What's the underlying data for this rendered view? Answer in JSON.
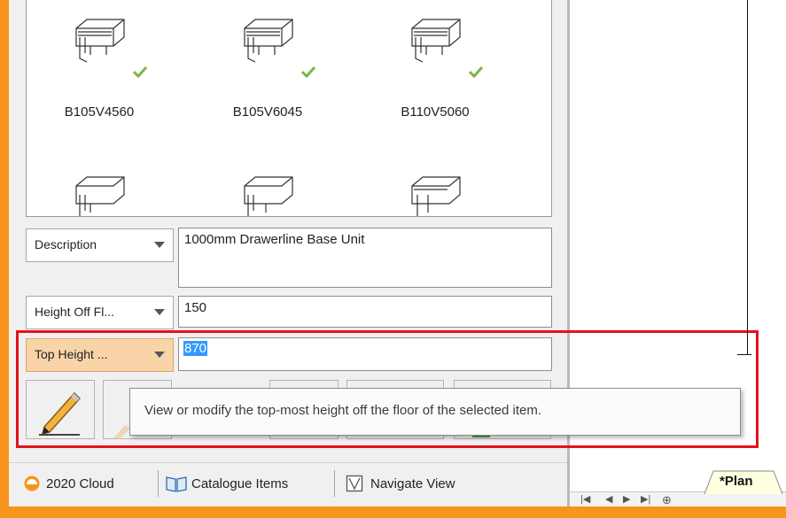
{
  "catalogue": {
    "items": [
      {
        "label": "B105V4560",
        "selected": true
      },
      {
        "label": "B105V6045",
        "selected": true
      },
      {
        "label": "B110V5060",
        "selected": true
      },
      {
        "label": "",
        "selected": false
      },
      {
        "label": "",
        "selected": false
      },
      {
        "label": "",
        "selected": false
      }
    ],
    "scroll_icon": "chevron-down-icon"
  },
  "properties": {
    "description": {
      "dropdown": "Description",
      "value": "1000mm Drawerline Base Unit"
    },
    "height_off_floor": {
      "dropdown": "Height Off Fl...",
      "value": "150"
    },
    "top_height": {
      "dropdown": "Top Height ...",
      "value": "870"
    }
  },
  "tooltip": "View or modify the top-most height off the floor of the selected item.",
  "tabs": [
    {
      "label": "2020 Cloud",
      "icon": "cloud-icon"
    },
    {
      "label": "Catalogue Items",
      "icon": "book-icon"
    },
    {
      "label": "Navigate View",
      "icon": "navigate-icon"
    }
  ],
  "view_tab": "*Plan",
  "colors": {
    "accent": "#f7941d",
    "highlight": "#e3121b",
    "check": "#7ab648"
  }
}
